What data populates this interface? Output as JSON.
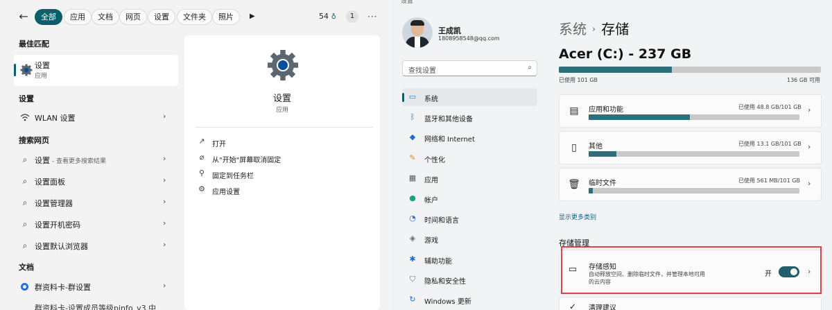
{
  "search": {
    "filters": [
      "全部",
      "应用",
      "文档",
      "网页",
      "设置",
      "文件夹",
      "照片"
    ],
    "points": "54",
    "notification_count": "1",
    "best_match": {
      "title": "最佳匹配",
      "name": "设置",
      "type": "应用"
    },
    "settings_section": {
      "title": "设置",
      "items": [
        {
          "label": "WLAN 设置"
        }
      ]
    },
    "web_section": {
      "title": "搜索网页",
      "items": [
        {
          "label": "设置",
          "sub": " - 查看更多搜索结果"
        },
        {
          "label": "设置面板",
          "sub": ""
        },
        {
          "label": "设置管理器",
          "sub": ""
        },
        {
          "label": "设置开机密码",
          "sub": ""
        },
        {
          "label": "设置默认浏览器",
          "sub": ""
        }
      ]
    },
    "docs_section": {
      "title": "文档",
      "items": [
        {
          "label": "群资料卡-群设置"
        }
      ],
      "cut_item": "群资料卡-设置成员等级pinfo_v3.中"
    },
    "detail": {
      "name": "设置",
      "type": "应用",
      "actions": [
        {
          "label": "打开",
          "icon": "open-external-icon"
        },
        {
          "label": "从\"开始\"屏幕取消固定",
          "icon": "unpin-icon"
        },
        {
          "label": "固定到任务栏",
          "icon": "pin-icon"
        },
        {
          "label": "应用设置",
          "icon": "gear-icon"
        }
      ]
    }
  },
  "settings": {
    "window_title": "设置",
    "user": {
      "name": "王成凯",
      "email": "1808958548@qq.com"
    },
    "search_placeholder": "查找设置",
    "nav": [
      {
        "label": "系统",
        "icon": "monitor-icon",
        "color": "#2b7bd6"
      },
      {
        "label": "蓝牙和其他设备",
        "icon": "bluetooth-icon",
        "color": "#1f6fd0"
      },
      {
        "label": "网络和 Internet",
        "icon": "wifi-icon",
        "color": "#1f6fd0"
      },
      {
        "label": "个性化",
        "icon": "brush-icon",
        "color": "#e0812c"
      },
      {
        "label": "应用",
        "icon": "apps-icon",
        "color": "#555b66"
      },
      {
        "label": "帐户",
        "icon": "account-icon",
        "color": "#1aa37a"
      },
      {
        "label": "时间和语言",
        "icon": "globe-clock-icon",
        "color": "#2a6fd0"
      },
      {
        "label": "游戏",
        "icon": "gamepad-icon",
        "color": "#666c74"
      },
      {
        "label": "辅助功能",
        "icon": "accessibility-icon",
        "color": "#1f6fd0"
      },
      {
        "label": "隐私和安全性",
        "icon": "shield-icon",
        "color": "#6b7280"
      },
      {
        "label": "Windows 更新",
        "icon": "update-icon",
        "color": "#1f6fd0"
      }
    ],
    "breadcrumb": {
      "parent": "系统",
      "current": "存储"
    },
    "drive": {
      "title": "Acer (C:) - 237 GB",
      "used": "已使用 101 GB",
      "free": "136 GB 可用",
      "used_fraction": 0.43
    },
    "categories": [
      {
        "label": "应用和功能",
        "used": "已使用 48.8 GB/101 GB",
        "fraction": 0.48,
        "icon": "apps-features-icon"
      },
      {
        "label": "其他",
        "used": "已使用 13.1 GB/101 GB",
        "fraction": 0.13,
        "icon": "other-files-icon"
      },
      {
        "label": "临时文件",
        "used": "已使用 561 MB/101 GB",
        "fraction": 0.02,
        "icon": "trash-icon"
      }
    ],
    "show_more": "显示更多类别",
    "management_title": "存储管理",
    "storage_sense": {
      "title": "存储感知",
      "desc": "自动释放空间、删除临时文件，并管理本地可用的云内容",
      "toggle_label": "开",
      "enabled": true
    },
    "cleanup": "清理建议",
    "accent": "#0a5f6a"
  }
}
